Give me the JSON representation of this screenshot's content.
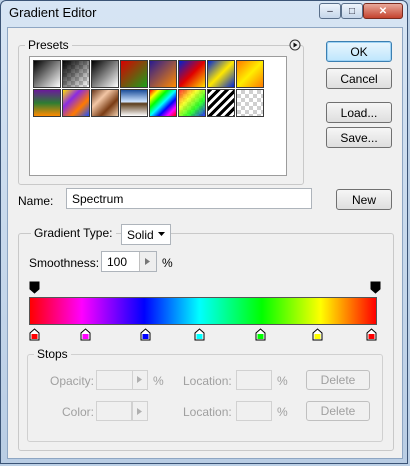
{
  "window": {
    "title": "Gradient Editor",
    "controls": [
      "–",
      "□",
      "✕"
    ]
  },
  "presets": {
    "label": "Presets",
    "menu_icon": "play-circle-icon",
    "swatches": [
      "fg-to-bg",
      "fg-to-transparent",
      "black-white",
      "red-green",
      "violet-orange",
      "blue-red-yellow",
      "blue-yellow-blue",
      "orange-yellow-orange",
      "violet-green-orange",
      "yellow-violet-orange-blue",
      "copper",
      "chrome",
      "spectrum",
      "transparent-rainbow",
      "transparent-stripes",
      "checker-transparent"
    ]
  },
  "buttons": {
    "ok": "OK",
    "cancel": "Cancel",
    "load": "Load...",
    "save": "Save...",
    "new": "New",
    "delete_opacity": "Delete",
    "delete_color": "Delete"
  },
  "name": {
    "label": "Name:",
    "value": "Spectrum"
  },
  "gradient": {
    "type_label": "Gradient Type:",
    "type_value": "Solid",
    "smoothness_label": "Smoothness:",
    "smoothness_value": "100",
    "smoothness_unit": "%",
    "opacity_stops": [
      0,
      1
    ],
    "color_stops": [
      {
        "pos": 0.0,
        "color": "#ff0000"
      },
      {
        "pos": 0.15,
        "color": "#ff00ff"
      },
      {
        "pos": 0.33,
        "color": "#0000ff"
      },
      {
        "pos": 0.49,
        "color": "#00ffff"
      },
      {
        "pos": 0.67,
        "color": "#00ff00"
      },
      {
        "pos": 0.84,
        "color": "#ffff00"
      },
      {
        "pos": 1.0,
        "color": "#ff0000"
      }
    ]
  },
  "stops": {
    "label": "Stops",
    "opacity_label": "Opacity:",
    "opacity_unit": "%",
    "color_label": "Color:",
    "location_label_1": "Location:",
    "location_label_2": "Location:",
    "location_unit_1": "%",
    "location_unit_2": "%"
  }
}
